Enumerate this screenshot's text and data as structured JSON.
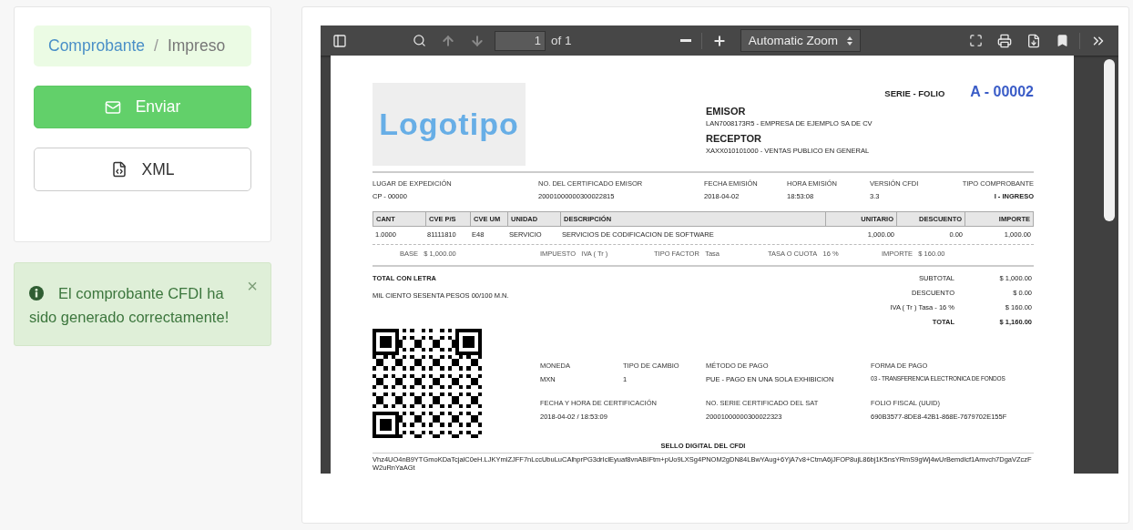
{
  "breadcrumb": {
    "items": [
      "Comprobante",
      "Impreso"
    ],
    "separator": "/"
  },
  "buttons": [
    {
      "kind": "primary",
      "label": "Enviar"
    },
    {
      "kind": "default",
      "label": "XML"
    }
  ],
  "alert": {
    "text": "El comprobante CFDI ha sido generado correctamente!",
    "close": "×"
  },
  "viewer": {
    "toolbar": {
      "page": "1",
      "page_count": "of 1",
      "zoom": "Automatic Zoom",
      "previous_disabled": true,
      "next_disabled": true
    },
    "invoice": {
      "logo": "Logotipo",
      "serie_folio_label": "SERIE - FOLIO",
      "serie_folio": "A - 00002",
      "emisor": {
        "label": "EMISOR",
        "value": "LAN7008173R5 - EMPRESA DE EJEMPLO SA DE CV"
      },
      "receptor": {
        "label": "RECEPTOR",
        "value": "XAXX010101000 - VENTAS PUBLICO EN GENERAL"
      },
      "info": [
        {
          "label": "LUGAR DE EXPEDICIÓN",
          "value": "CP - 00000"
        },
        {
          "label": "NO. DEL CERTIFICADO EMISOR",
          "value": "20001000000300022815"
        },
        {
          "label": "FECHA EMISIÓN",
          "value": "2018-04-02"
        },
        {
          "label": "HORA EMISIÓN",
          "value": "18:53:08"
        },
        {
          "label": "VERSIÓN CFDI",
          "value": "3.3"
        },
        {
          "label": "TIPO COMPROBANTE",
          "value": "I - INGRESO"
        }
      ],
      "columns": [
        "CANT",
        "CVE P/S",
        "CVE UM",
        "UNIDAD",
        "DESCRIPCIÓN",
        "UNITARIO",
        "DESCUENTO",
        "IMPORTE"
      ],
      "rows": [
        {
          "cells": [
            "1.0000",
            "81111810",
            "E48",
            "SERVICIO",
            "SERVICIOS DE CODIFICACION DE SOFTWARE",
            "1,000.00",
            "0.00",
            "1,000.00"
          ],
          "taxes": [
            {
              "label": "BASE",
              "value": "$ 1,000.00"
            },
            {
              "label": "IMPUESTO",
              "value": "IVA ( Tr )"
            },
            {
              "label": "TIPO FACTOR",
              "value": "Tasa"
            },
            {
              "label": "TASA O CUOTA",
              "value": "16 %"
            },
            {
              "label": "IMPORTE",
              "value": "$ 160.00"
            }
          ]
        }
      ],
      "total_letra": {
        "label": "TOTAL CON LETRA",
        "value": "MIL CIENTO SESENTA PESOS 00/100 M.N."
      },
      "totals": [
        {
          "label": "SUBTOTAL",
          "value": "$ 1,000.00",
          "bold": false
        },
        {
          "label": "DESCUENTO",
          "value": "$ 0.00",
          "bold": false
        },
        {
          "label": "IVA ( Tr ) Tasa - 16 %",
          "value": "$ 160.00",
          "bold": false
        },
        {
          "label": "TOTAL",
          "value": "$ 1,160.00",
          "bold": true
        }
      ],
      "payment": [
        {
          "label": "MONEDA",
          "value": "MXN"
        },
        {
          "label": "TIPO DE CAMBIO",
          "value": "1"
        },
        {
          "label": "MÉTODO DE PAGO",
          "value": "PUE - PAGO EN UNA SOLA EXHIBICION"
        },
        {
          "label": "FORMA DE PAGO",
          "value": "03 - TRANSFERENCIA ELECTRONICA DE FONDOS",
          "small": true
        },
        {
          "label": "FECHA Y HORA DE CERTIFICACIÓN",
          "value": "2018-04-02 / 18:53:09",
          "wide": true
        },
        {
          "label": "NO. SERIE CERTIFICADO DEL SAT",
          "value": "20001000000300022323"
        },
        {
          "label": "FOLIO FISCAL (UUID)",
          "value": "690B3577-8DE8-42B1-868E-7679702E155F"
        }
      ],
      "seal_label": "SELLO DIGITAL DEL CFDI",
      "seal": "Vhz4UO4nB9YTGmoKDaTcjalC0eH.LJKYmlZJFF7nLccUbuLuCAlhprPG3drIclEyuaf8vnABIFtm+pUo9LXSg4PNOM2gDN84LBwYAug+6YjA7v8+CtmA6jJFOP8ujL86bj1K5nsYRmS9gWj4wUrBemdlcf1Amvch7DgaVZczFW2uRnYaAGt"
    }
  }
}
